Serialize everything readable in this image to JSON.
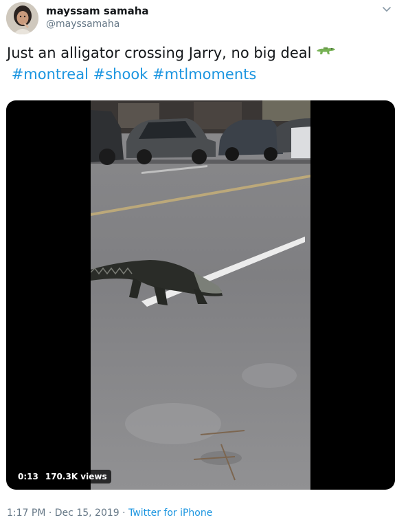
{
  "author": {
    "display_name": "mayssam samaha",
    "handle": "@mayssamaha",
    "avatar_icon": "profile-photo",
    "menu_icon": "chevron-down-icon"
  },
  "tweet": {
    "text_line1": "Just an alligator crossing Jarry, no big deal",
    "emoji_icon": "crocodile-emoji",
    "hashtags": [
      "#montreal",
      "#shook",
      "#mtlmoments"
    ],
    "link_color": "#1b95e0"
  },
  "media": {
    "type": "video",
    "duration": "0:13",
    "views": "170.3K views"
  },
  "meta": {
    "time": "1:17 PM",
    "separator": "·",
    "date": "Dec 15, 2019",
    "source": "Twitter for iPhone"
  }
}
